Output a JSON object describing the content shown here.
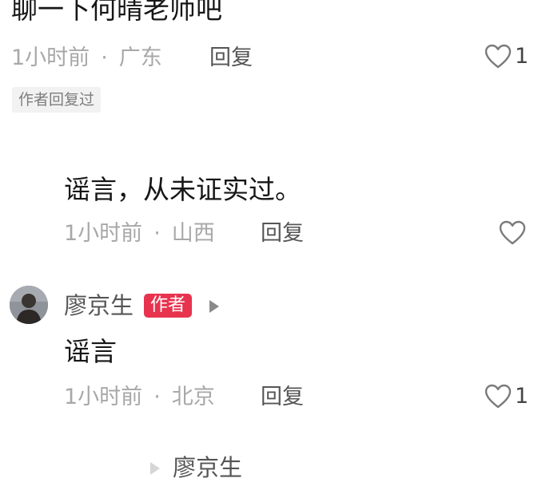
{
  "comments": [
    {
      "content": "聊一下何晴老师吧",
      "time": "1小时前",
      "location": "广东",
      "reply_label": "回复",
      "likes": "1",
      "tag": "作者回复过"
    },
    {
      "content": "谣言，从未证实过。",
      "time": "1小时前",
      "location": "山西",
      "reply_label": "回复"
    },
    {
      "username": "廖京生",
      "badge": "作者",
      "content": "谣言",
      "time": "1小时前",
      "location": "北京",
      "reply_label": "回复",
      "likes": "1"
    }
  ],
  "partial": {
    "username": "廖京生"
  },
  "meta_separator": "·",
  "icons": {
    "like": "heart-outline-icon",
    "play": "play-triangle-icon"
  },
  "colors": {
    "author_badge": "#e8334f",
    "meta": "#a8a8a8"
  }
}
